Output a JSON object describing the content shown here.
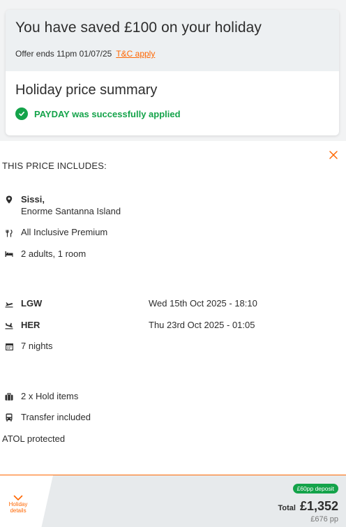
{
  "summary": {
    "saved_title": "You have saved £100 on your holiday",
    "offer_text": "Offer ends 11pm 01/07/25",
    "tc_link": "T&C apply",
    "title": "Holiday price summary",
    "applied_text": "PAYDAY was successfully applied"
  },
  "includes": {
    "title": "THIS PRICE INCLUDES:",
    "location_line1": "Sissi,",
    "location_line2": "Enorme Santanna Island",
    "board": "All Inclusive Premium",
    "occupancy": "2 adults, 1 room",
    "outbound_airport": "LGW",
    "outbound_time": "Wed 15th Oct 2025 - 18:10",
    "return_airport": "HER",
    "return_time": "Thu 23rd Oct 2025 - 01:05",
    "nights": "7 nights",
    "hold_items": "2 x Hold items",
    "transfer": "Transfer included",
    "atol": "ATOL protected"
  },
  "footer": {
    "details_label": "Holiday details",
    "deposit_badge": "£60pp deposit",
    "total_label": "Total",
    "total_value": "£1,352",
    "pp_value": "£676 pp"
  },
  "colors": {
    "accent": "#ff6600",
    "success": "#14a34a"
  },
  "icons": [
    "location-pin-icon",
    "cutlery-icon",
    "bed-icon",
    "plane-takeoff-icon",
    "plane-landing-icon",
    "calendar-icon",
    "luggage-icon",
    "bus-icon",
    "close-icon",
    "check-icon",
    "chevron-down-icon"
  ]
}
